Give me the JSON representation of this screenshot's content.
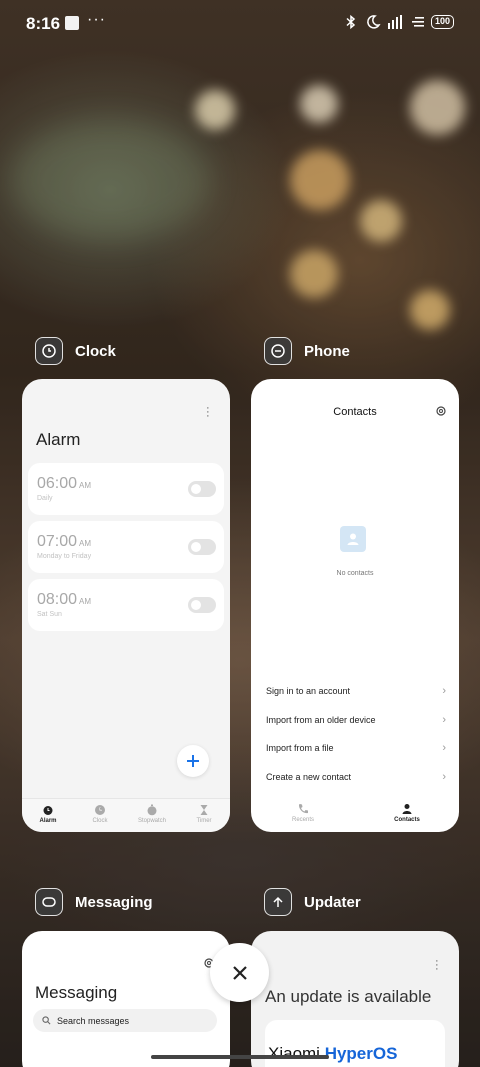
{
  "status_bar": {
    "time": "8:16",
    "more": "···",
    "battery": "100",
    "icons": [
      "notification-square-icon",
      "bluetooth-icon",
      "do-not-disturb-moon-icon",
      "signal-icon",
      "wifi-icon",
      "battery-icon"
    ]
  },
  "apps": [
    {
      "name": "Clock",
      "icon": "clock-icon",
      "screen": {
        "title": "Alarm",
        "alarms": [
          {
            "time": "06:00",
            "ampm": "AM",
            "repeat": "Daily"
          },
          {
            "time": "07:00",
            "ampm": "AM",
            "repeat": "Monday to Friday"
          },
          {
            "time": "08:00",
            "ampm": "AM",
            "repeat": "Sat Sun"
          }
        ],
        "tabs": [
          "Alarm",
          "Clock",
          "Stopwatch",
          "Timer"
        ],
        "active_tab": "Alarm"
      }
    },
    {
      "name": "Phone",
      "icon": "phone-icon",
      "screen": {
        "title": "Contacts",
        "empty_text": "No contacts",
        "actions": [
          "Sign in to an account",
          "Import from an older device",
          "Import from a file",
          "Create a new contact"
        ],
        "tabs": [
          "Recents",
          "Contacts"
        ],
        "active_tab": "Contacts"
      }
    },
    {
      "name": "Messaging",
      "icon": "messaging-icon",
      "screen": {
        "title": "Messaging",
        "search_placeholder": "Search messages"
      }
    },
    {
      "name": "Updater",
      "icon": "updater-icon",
      "screen": {
        "title": "An update is available",
        "brand_prefix": "Xiaomi ",
        "brand_suffix": "HyperOS"
      }
    }
  ],
  "colors": {
    "accent": "#1a73e8",
    "brand_blue": "#1565d8",
    "contact_placeholder": "#d4e6f5"
  }
}
